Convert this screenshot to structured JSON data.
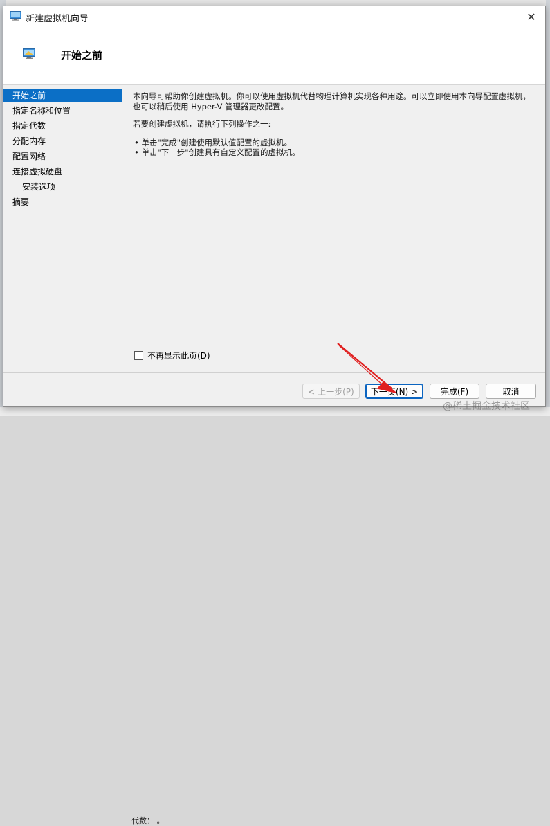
{
  "background": {
    "bottom_text": "代数：   。"
  },
  "window": {
    "title": "新建虚拟机向导",
    "close_glyph": "✕"
  },
  "header": {
    "title": "开始之前"
  },
  "nav": {
    "items": [
      {
        "label": "开始之前",
        "selected": true,
        "sub": false
      },
      {
        "label": "指定名称和位置",
        "selected": false,
        "sub": false
      },
      {
        "label": "指定代数",
        "selected": false,
        "sub": false
      },
      {
        "label": "分配内存",
        "selected": false,
        "sub": false
      },
      {
        "label": "配置网络",
        "selected": false,
        "sub": false
      },
      {
        "label": "连接虚拟硬盘",
        "selected": false,
        "sub": false
      },
      {
        "label": "安装选项",
        "selected": false,
        "sub": true
      },
      {
        "label": "摘要",
        "selected": false,
        "sub": false
      }
    ]
  },
  "content": {
    "para1": "本向导可帮助你创建虚拟机。你可以使用虚拟机代替物理计算机实现各种用途。可以立即使用本向导配置虚拟机，也可以稍后使用 Hyper-V 管理器更改配置。",
    "para2": "若要创建虚拟机，请执行下列操作之一:",
    "bullet1": "• 单击\"完成\"创建使用默认值配置的虚拟机。",
    "bullet2": "• 单击\"下一步\"创建具有自定义配置的虚拟机。"
  },
  "checkbox": {
    "label": "不再显示此页(D)",
    "checked": false
  },
  "buttons": {
    "prev": "< 上一步(P)",
    "next": "下一页(N) >",
    "finish": "完成(F)",
    "cancel": "取消"
  },
  "watermark": "@稀土掘金技术社区",
  "colors": {
    "selection": "#0b6fc6",
    "annotation_arrow": "#e02020"
  },
  "icons": {
    "title": "monitor-icon",
    "header": "monitor-icon",
    "close": "close-icon"
  }
}
